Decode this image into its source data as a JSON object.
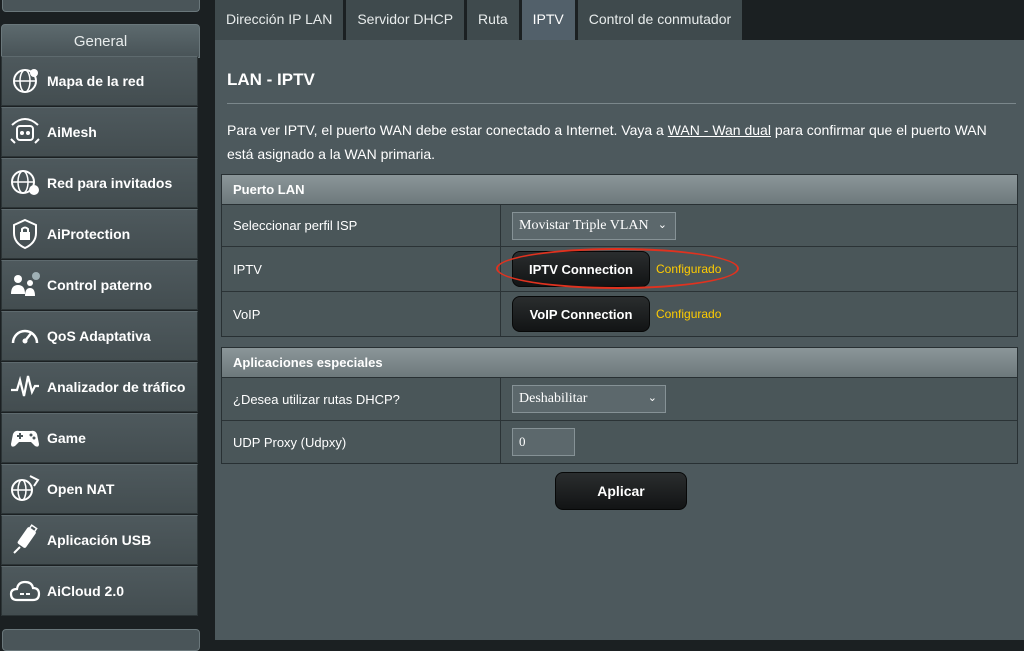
{
  "sidebar": {
    "header": "General",
    "items": [
      {
        "label": "Mapa de la red",
        "icon": "network-map-icon"
      },
      {
        "label": "AiMesh",
        "icon": "aimesh-icon"
      },
      {
        "label": "Red para invitados",
        "icon": "guest-network-icon"
      },
      {
        "label": "AiProtection",
        "icon": "shield-lock-icon"
      },
      {
        "label": "Control paterno",
        "icon": "parental-control-icon"
      },
      {
        "label": "QoS Adaptativa",
        "icon": "qos-gauge-icon"
      },
      {
        "label": "Analizador de tráfico",
        "icon": "traffic-analyzer-icon"
      },
      {
        "label": "Game",
        "icon": "gamepad-icon"
      },
      {
        "label": "Open NAT",
        "icon": "open-nat-icon"
      },
      {
        "label": "Aplicación USB",
        "icon": "usb-icon"
      },
      {
        "label": "AiCloud 2.0",
        "icon": "cloud-icon"
      }
    ]
  },
  "tabs": [
    {
      "label": "Dirección IP LAN",
      "active": false
    },
    {
      "label": "Servidor DHCP",
      "active": false
    },
    {
      "label": "Ruta",
      "active": false
    },
    {
      "label": "IPTV",
      "active": true
    },
    {
      "label": "Control de conmutador",
      "active": false
    }
  ],
  "page": {
    "title": "LAN - IPTV",
    "desc_before": "Para ver IPTV, el puerto WAN debe estar conectado a Internet. Vaya a ",
    "desc_link": "WAN - Wan dual",
    "desc_after": " para confirmar que el puerto WAN está asignado a la WAN primaria."
  },
  "lan_port": {
    "header": "Puerto LAN",
    "isp_label": "Seleccionar perfil ISP",
    "isp_value": "Movistar Triple VLAN",
    "iptv_label": "IPTV",
    "iptv_button": "IPTV Connection",
    "iptv_status": "Configurado",
    "voip_label": "VoIP",
    "voip_button": "VoIP Connection",
    "voip_status": "Configurado"
  },
  "special_apps": {
    "header": "Aplicaciones especiales",
    "dhcp_label": "¿Desea utilizar rutas DHCP?",
    "dhcp_value": "Deshabilitar",
    "udp_label": "UDP Proxy (Udpxy)",
    "udp_value": "0"
  },
  "apply_label": "Aplicar",
  "colors": {
    "status": "#ffcc00",
    "highlight_circle": "#e0321f"
  }
}
